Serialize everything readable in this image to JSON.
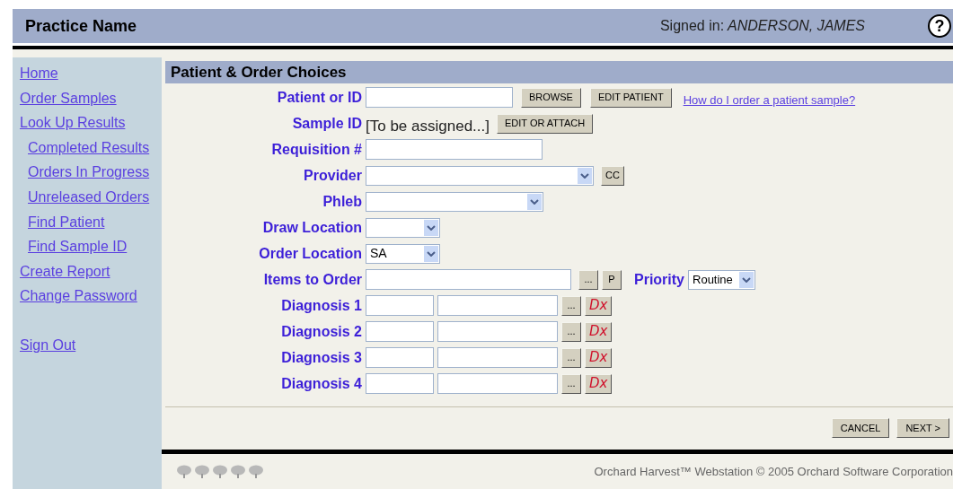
{
  "header": {
    "title": "Practice Name",
    "signed_in_label": "Signed in:",
    "user": "ANDERSON, JAMES",
    "help": "?"
  },
  "sidebar": {
    "items": [
      {
        "label": "Home"
      },
      {
        "label": "Order Samples"
      },
      {
        "label": "Look Up Results",
        "children": [
          {
            "label": "Completed Results"
          },
          {
            "label": "Orders In Progress"
          },
          {
            "label": "Unreleased Orders"
          },
          {
            "label": "Find Patient"
          },
          {
            "label": "Find Sample ID"
          }
        ]
      },
      {
        "label": "Create Report"
      },
      {
        "label": "Change Password"
      }
    ],
    "sign_out": "Sign Out"
  },
  "form": {
    "title": "Patient & Order Choices",
    "rows": [
      {
        "kind": "input",
        "label": "Patient or ID",
        "buttons": [
          "BROWSE",
          "EDIT PATIENT"
        ],
        "link": "How do I order a patient sample?"
      },
      {
        "kind": "static",
        "label": "Sample ID",
        "value": "[To be assigned...]",
        "buttons": [
          "EDIT OR ATTACH"
        ]
      },
      {
        "kind": "input",
        "label": "Requisition #"
      },
      {
        "kind": "select",
        "label": "Provider",
        "buttons": [
          "CC"
        ]
      },
      {
        "kind": "select",
        "label": "Phleb"
      },
      {
        "kind": "select",
        "label": "Draw Location"
      },
      {
        "kind": "select",
        "label": "Order Location",
        "value": "SA"
      },
      {
        "kind": "input",
        "label": "Items to Order",
        "buttons": [
          "...",
          "P"
        ],
        "priority": {
          "label": "Priority",
          "value": "Routine"
        }
      },
      {
        "kind": "diagnosis",
        "label": "Diagnosis 1",
        "buttons": [
          "...",
          "Dx"
        ]
      },
      {
        "kind": "diagnosis",
        "label": "Diagnosis 2",
        "buttons": [
          "...",
          "Dx"
        ]
      },
      {
        "kind": "diagnosis",
        "label": "Diagnosis 3",
        "buttons": [
          "...",
          "Dx"
        ]
      },
      {
        "kind": "diagnosis",
        "label": "Diagnosis 4",
        "buttons": [
          "...",
          "Dx"
        ]
      }
    ],
    "actions": [
      "CANCEL",
      "NEXT >"
    ]
  },
  "footer": {
    "copyright": "Orchard Harvest™ Webstation © 2005 Orchard Software Corporation"
  }
}
